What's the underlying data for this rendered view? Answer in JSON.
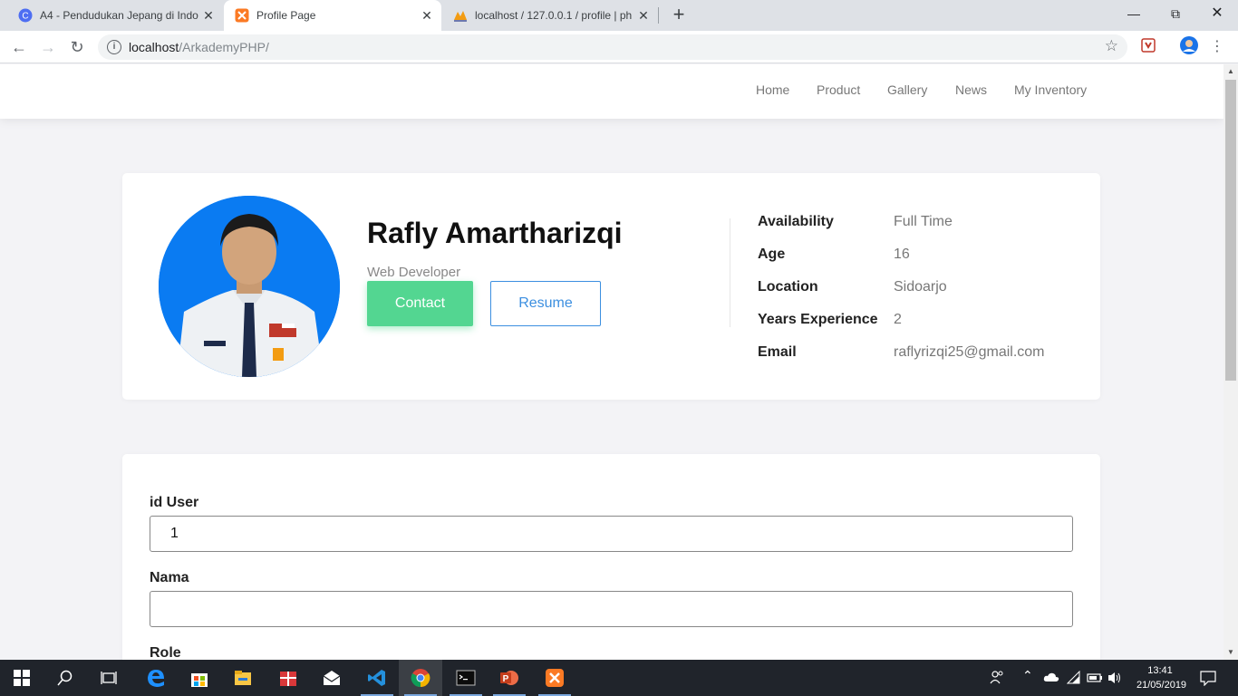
{
  "browser": {
    "tabs": [
      {
        "title": "A4 - Pendudukan Jepang di Indo",
        "active": false
      },
      {
        "title": "Profile Page",
        "active": true
      },
      {
        "title": "localhost / 127.0.0.1 / profile | ph",
        "active": false
      }
    ],
    "url_host": "localhost",
    "url_path": "/ArkademyPHP/"
  },
  "nav": {
    "links": [
      "Home",
      "Product",
      "Gallery",
      "News",
      "My Inventory"
    ]
  },
  "profile": {
    "name": "Rafly Amartharizqi",
    "role": "Web Developer",
    "contact_label": "Contact",
    "resume_label": "Resume",
    "info": [
      {
        "label": "Availability",
        "value": "Full Time"
      },
      {
        "label": "Age",
        "value": "16"
      },
      {
        "label": "Location",
        "value": "Sidoarjo"
      },
      {
        "label": "Years Experience",
        "value": "2"
      },
      {
        "label": "Email",
        "value": "raflyrizqi25@gmail.com"
      }
    ]
  },
  "form": {
    "fields": [
      {
        "label": "id User",
        "value": "1"
      },
      {
        "label": "Nama",
        "value": ""
      },
      {
        "label": "Role",
        "value": ""
      }
    ]
  },
  "taskbar": {
    "time": "13:41",
    "date": "21/05/2019"
  },
  "colors": {
    "contact_button": "#53d691",
    "resume_border": "#3c8fe0",
    "avatar_background": "#0a7bf2"
  }
}
